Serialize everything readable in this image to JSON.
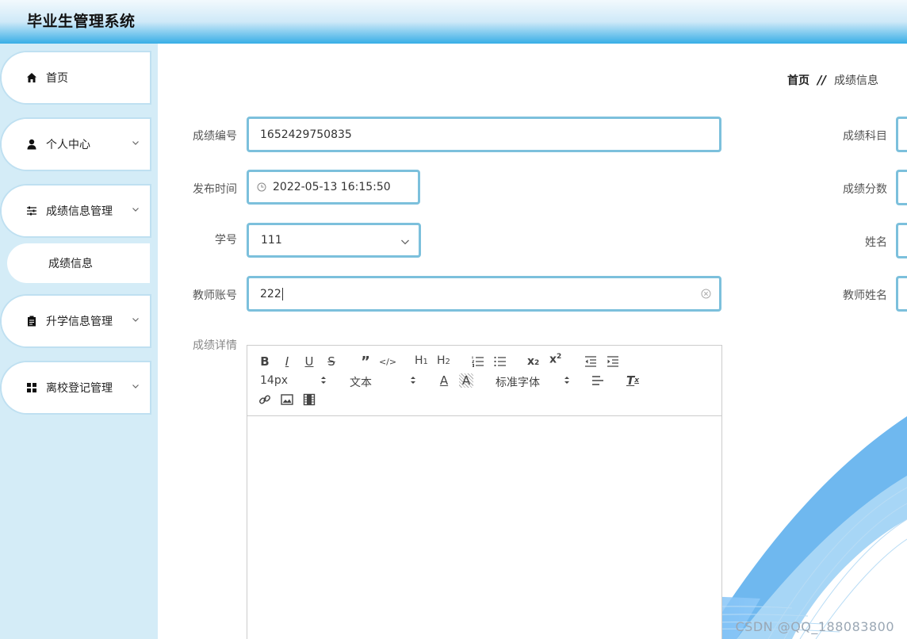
{
  "header": {
    "title": "毕业生管理系统"
  },
  "sidebar": {
    "items": [
      {
        "label": "首页"
      },
      {
        "label": "个人中心"
      },
      {
        "label": "成绩信息管理"
      },
      {
        "label": "升学信息管理"
      },
      {
        "label": "离校登记管理"
      }
    ],
    "subitem": {
      "label": "成绩信息"
    }
  },
  "breadcrumb": {
    "home": "首页",
    "separator": "//",
    "current": "成绩信息"
  },
  "form": {
    "score_no": {
      "label": "成绩编号",
      "value": "1652429750835"
    },
    "subject": {
      "label": "成绩科目"
    },
    "publish_time": {
      "label": "发布时间",
      "value": "2022-05-13 16:15:50"
    },
    "score": {
      "label": "成绩分数"
    },
    "student_no": {
      "label": "学号",
      "value": "111"
    },
    "name": {
      "label": "姓名"
    },
    "teacher_account": {
      "label": "教师账号",
      "value": "222"
    },
    "teacher_name": {
      "label": "教师姓名"
    },
    "details": {
      "label": "成绩详情"
    }
  },
  "editor": {
    "font_size": "14px",
    "text_type": "文本",
    "font_family": "标准字体",
    "h1": "H1",
    "h2": "H2"
  },
  "watermark": "CSDN @QQ_188083800"
}
